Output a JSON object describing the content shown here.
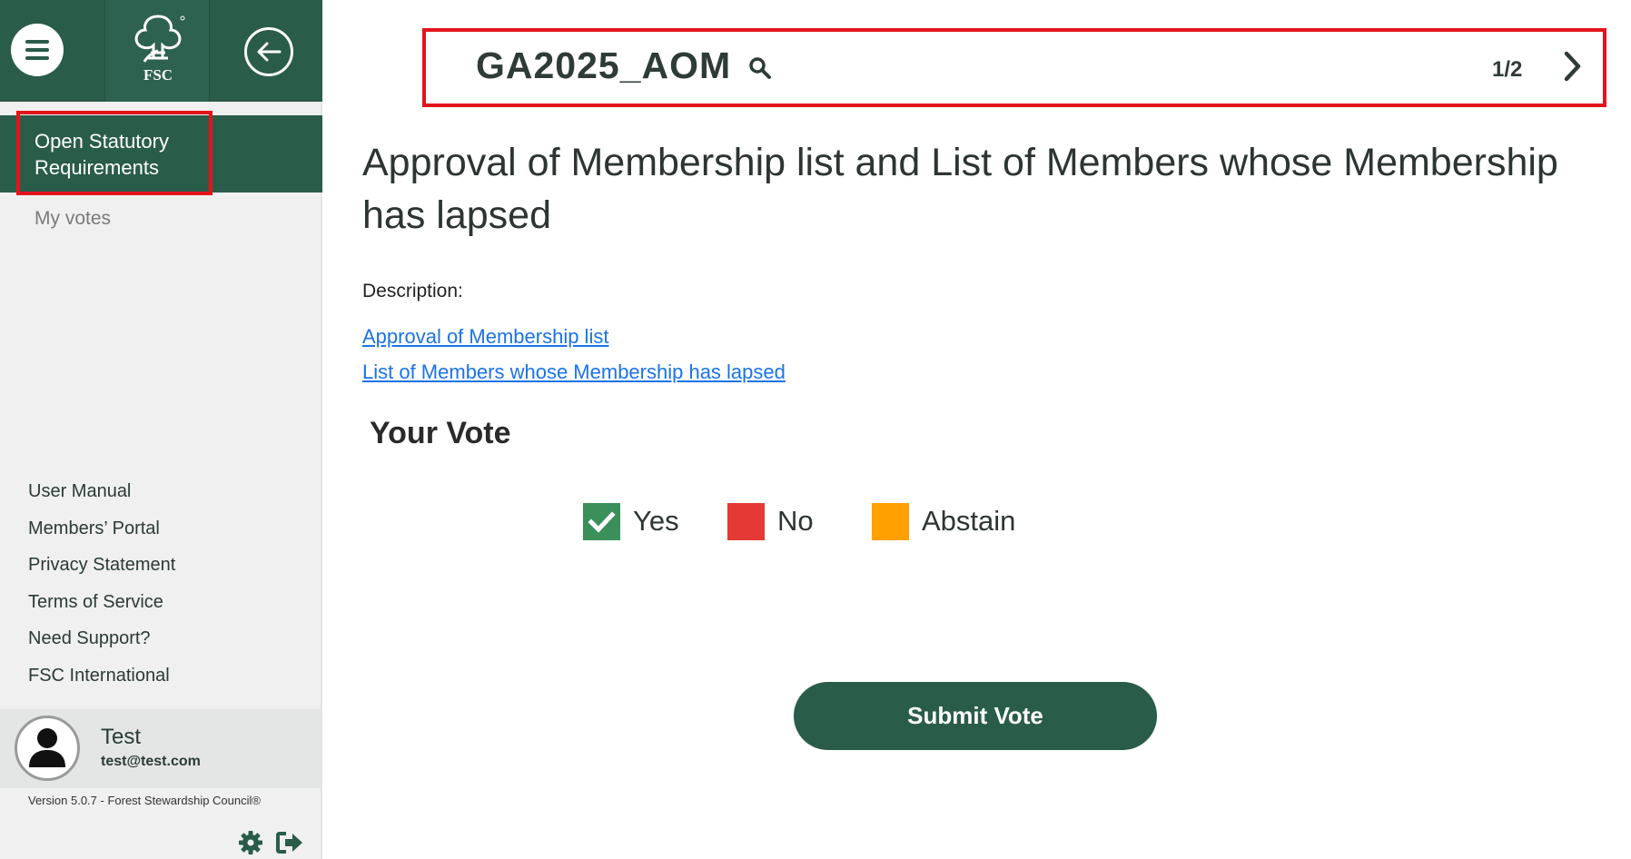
{
  "sidebar": {
    "logo_text": "FSC",
    "nav": {
      "active_label": "Open Statutory Requirements",
      "votes_label": "My votes"
    },
    "links": [
      "User Manual",
      "Members’ Portal",
      "Privacy Statement",
      "Terms of Service",
      "Need Support?",
      "FSC International"
    ],
    "user": {
      "name": "Test",
      "email": "test@test.com"
    },
    "version": "Version 5.0.7 - Forest Stewardship Council®"
  },
  "header": {
    "code": "GA2025_AOM",
    "pager": "1/2"
  },
  "main": {
    "title": "Approval of Membership list and List of Members whose Membership has lapsed",
    "description_label": "Description:",
    "links": [
      "Approval of Membership list",
      "List of Members whose Membership has lapsed"
    ],
    "vote_heading": "Your Vote",
    "options": [
      {
        "label": "Yes",
        "color": "#3a8f5a",
        "checked": true
      },
      {
        "label": "No",
        "color": "#e53935",
        "checked": false
      },
      {
        "label": "Abstain",
        "color": "#ffa000",
        "checked": false
      }
    ],
    "submit_label": "Submit Vote"
  },
  "colors": {
    "brand": "#2a5c4a",
    "highlight": "#e3141b",
    "link": "#1a73e8"
  }
}
